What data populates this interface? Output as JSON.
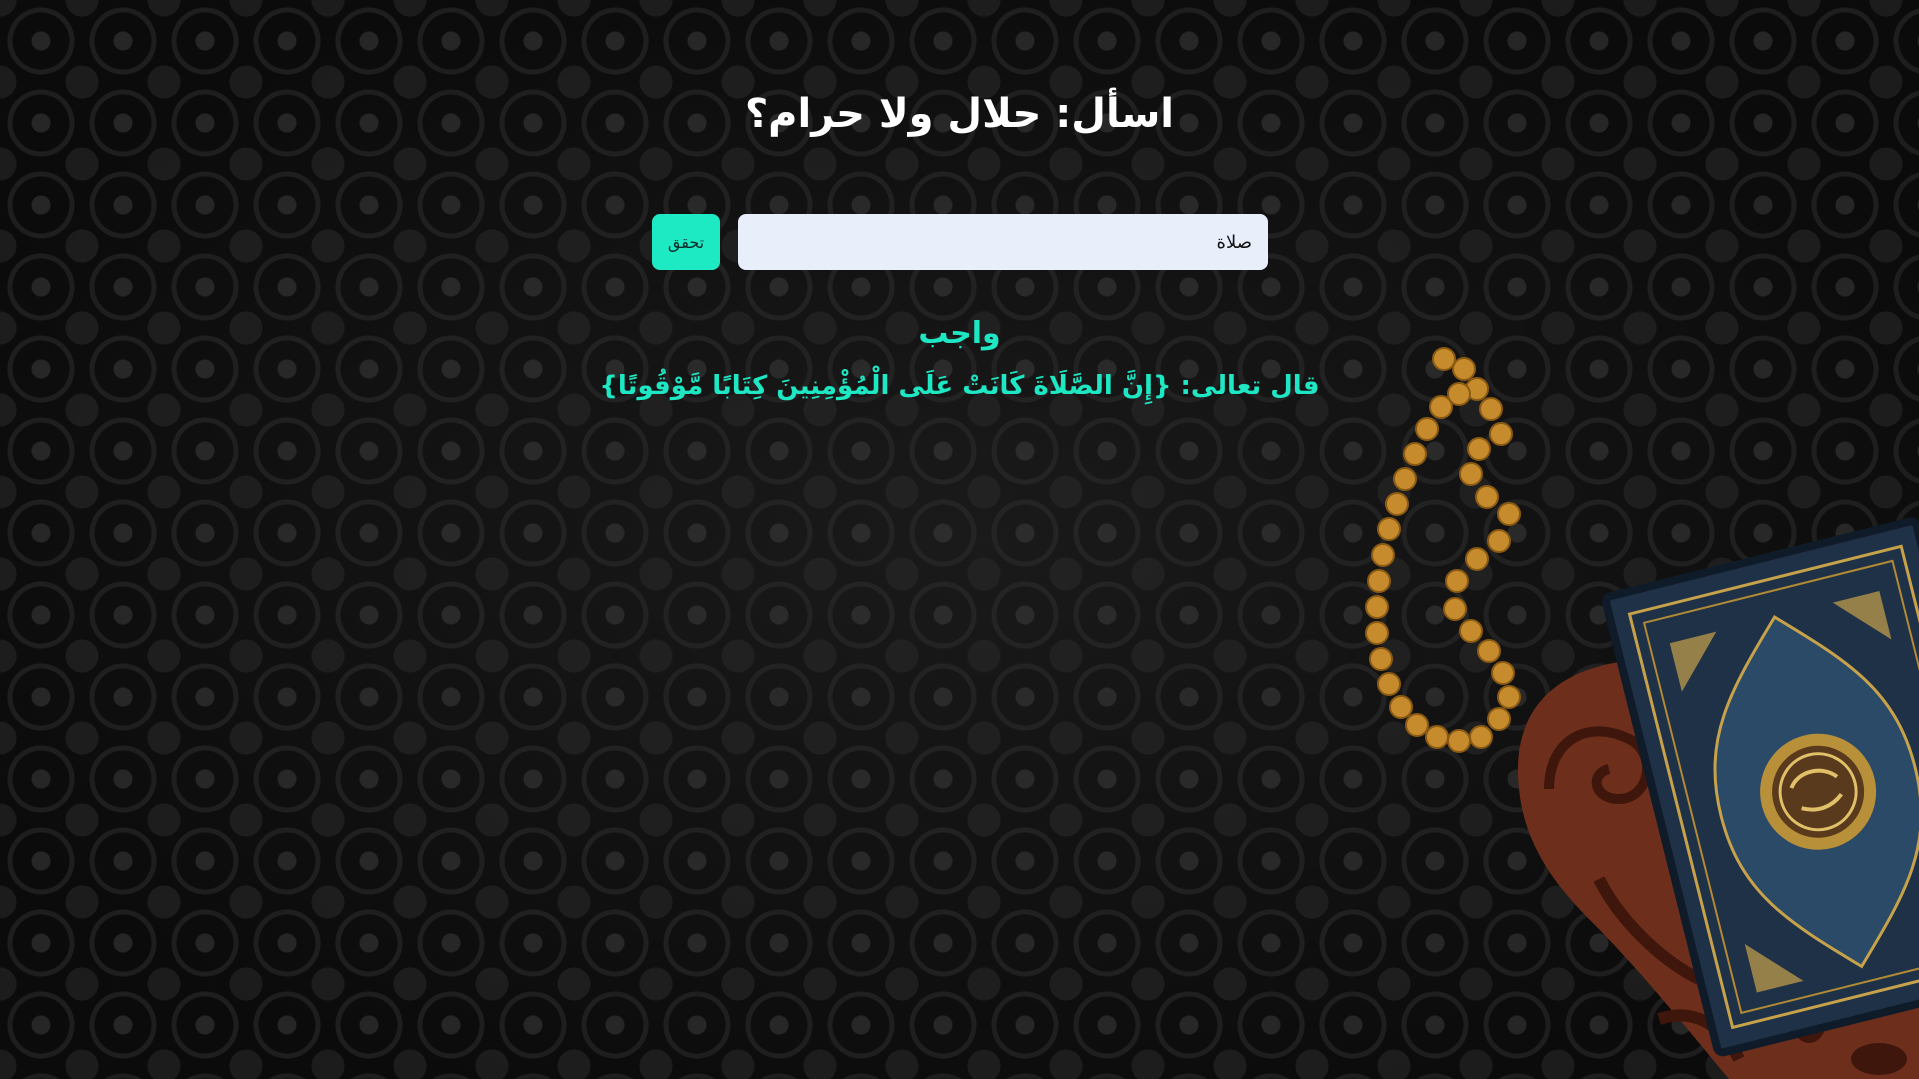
{
  "header": {
    "title": "اسأل: حلال ولا حرام؟"
  },
  "search": {
    "value": "صلاة",
    "button_label": "تحقق"
  },
  "result": {
    "verdict": "واجب",
    "evidence": "قال تعالى: {إِنَّ الصَّلَاةَ كَانَتْ عَلَى الْمُؤْمِنِينَ كِتَابًا مَّوْقُوتًا}"
  },
  "colors": {
    "accent": "#1ee8c4",
    "input_background": "#e8eefa",
    "title": "#ffffff",
    "background": "#0d0d0d"
  },
  "decoration": {
    "icons": [
      "quran-book-icon",
      "prayer-beads-icon",
      "wooden-book-stand-icon"
    ]
  }
}
